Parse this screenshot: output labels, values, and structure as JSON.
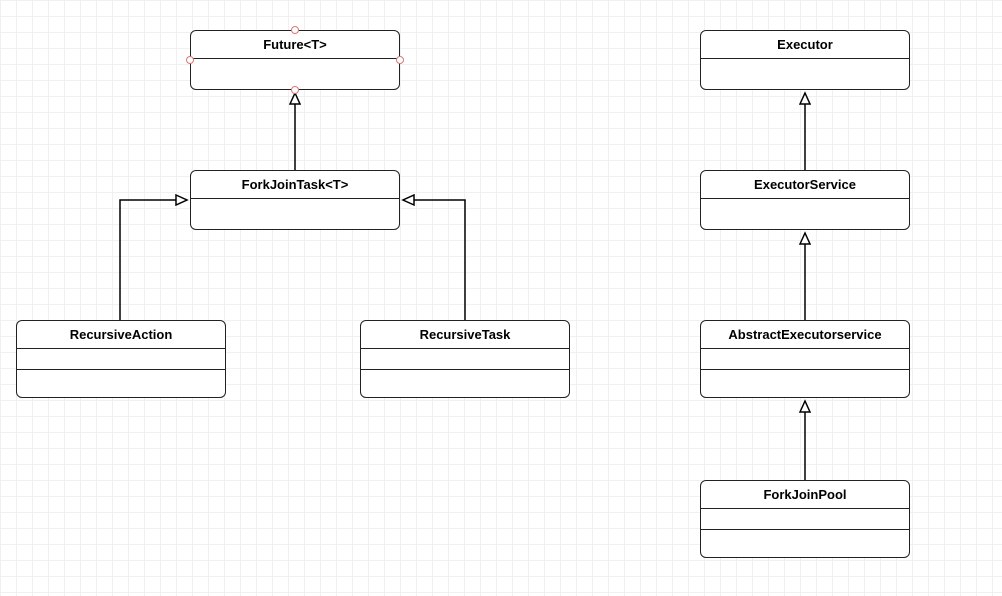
{
  "diagram": {
    "boxes": {
      "future": {
        "label": "Future<T>"
      },
      "forkJoinTask": {
        "label": "ForkJoinTask<T>"
      },
      "recursiveAction": {
        "label": "RecursiveAction"
      },
      "recursiveTask": {
        "label": "RecursiveTask"
      },
      "executor": {
        "label": "Executor"
      },
      "executorService": {
        "label": "ExecutorService"
      },
      "abstractExecutorService": {
        "label": "AbstractExecutorservice"
      },
      "forkJoinPool": {
        "label": "ForkJoinPool"
      }
    },
    "selected": "future"
  },
  "chart_data": {
    "type": "uml-class-diagram",
    "nodes": [
      {
        "id": "Future<T>",
        "selected": true
      },
      {
        "id": "ForkJoinTask<T>"
      },
      {
        "id": "RecursiveAction"
      },
      {
        "id": "RecursiveTask"
      },
      {
        "id": "Executor"
      },
      {
        "id": "ExecutorService"
      },
      {
        "id": "AbstractExecutorservice"
      },
      {
        "id": "ForkJoinPool"
      }
    ],
    "edges": [
      {
        "from": "ForkJoinTask<T>",
        "to": "Future<T>",
        "relation": "realization"
      },
      {
        "from": "RecursiveAction",
        "to": "ForkJoinTask<T>",
        "relation": "generalization"
      },
      {
        "from": "RecursiveTask",
        "to": "ForkJoinTask<T>",
        "relation": "generalization"
      },
      {
        "from": "ExecutorService",
        "to": "Executor",
        "relation": "generalization"
      },
      {
        "from": "AbstractExecutorservice",
        "to": "ExecutorService",
        "relation": "generalization"
      },
      {
        "from": "ForkJoinPool",
        "to": "AbstractExecutorservice",
        "relation": "generalization"
      }
    ]
  }
}
